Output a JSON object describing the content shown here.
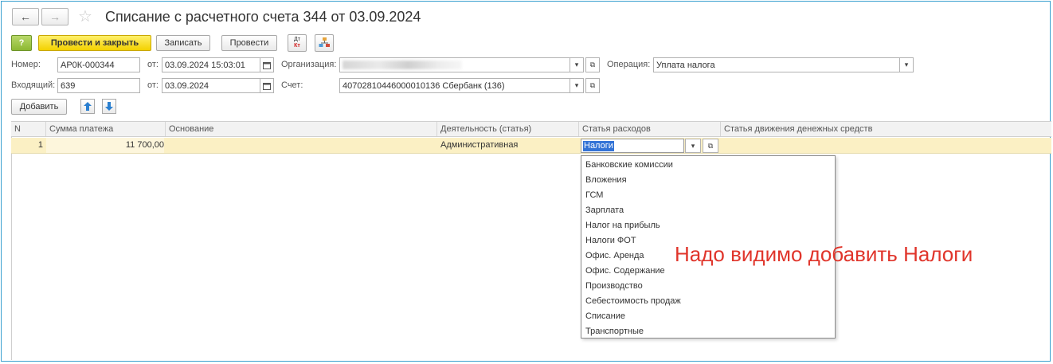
{
  "window": {
    "title": "Списание с расчетного счета 344 от 03.09.2024",
    "nav_back": "←",
    "nav_forward": "→",
    "favorite_star": "☆"
  },
  "toolbar": {
    "help_icon": "?",
    "post_close_label": "Провести и закрыть",
    "save_label": "Записать",
    "post_label": "Провести",
    "dtkt_label_top": "Дт",
    "dtkt_label_bottom": "Кт"
  },
  "form": {
    "number_label": "Номер:",
    "number_value": "АР0К-000344",
    "from_label": "от:",
    "date_value": "03.09.2024 15:03:01",
    "org_label": "Организация:",
    "operation_label": "Операция:",
    "operation_value": "Уплата налога",
    "incoming_label": "Входящий:",
    "incoming_value": "639",
    "incoming_from_label": "от:",
    "incoming_date_value": "03.09.2024",
    "account_label": "Счет:",
    "account_value": "40702810446000010136 Сбербанк (136)"
  },
  "table_toolbar": {
    "add_label": "Добавить",
    "up_icon": "🡅",
    "down_icon": "🡇"
  },
  "table": {
    "columns": [
      "N",
      "Сумма платежа",
      "Основание",
      "Деятельность (статья)",
      "Статья расходов",
      "Статья движения денежных средств"
    ],
    "row": {
      "n": "1",
      "amount": "11 700,00",
      "basis": "",
      "activity": "Административная",
      "expense": "Налоги",
      "cashflow": ""
    }
  },
  "dropdown": {
    "items": [
      "Банковские комиссии",
      "Вложения",
      "ГСМ",
      "Зарплата",
      "Налог на прибыль",
      "Налоги ФОТ",
      "Офис. Аренда",
      "Офис. Содержание",
      "Производство",
      "Себестоимость продаж",
      "Списание",
      "Транспортные"
    ]
  },
  "annotation": {
    "text": "Надо видимо добавить Налоги",
    "color": "#e0352b"
  }
}
